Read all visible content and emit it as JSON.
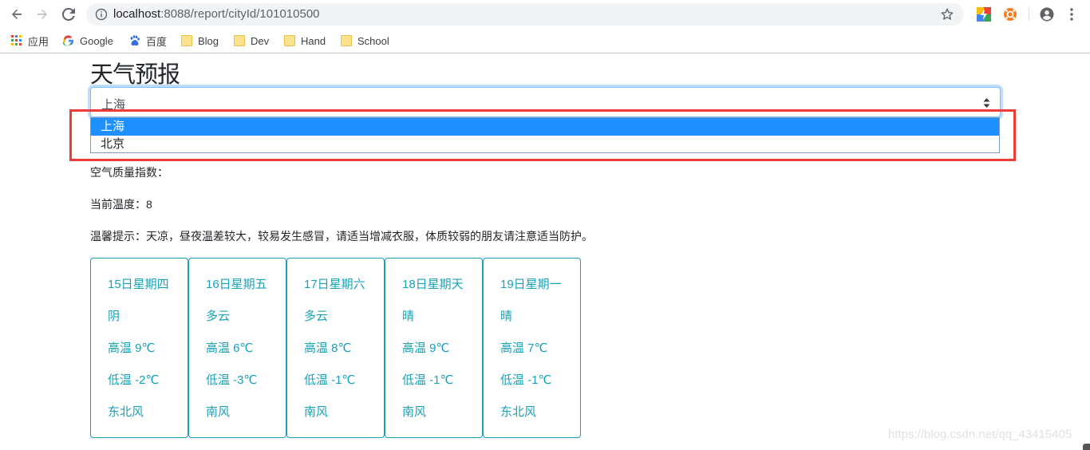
{
  "browser": {
    "url_host": "localhost",
    "url_path": ":8088/report/cityId/101010500",
    "bookmarks": [
      {
        "label": "应用",
        "icon": "apps-grid-icon"
      },
      {
        "label": "Google",
        "icon": "google-icon"
      },
      {
        "label": "百度",
        "icon": "baidu-paw-icon"
      },
      {
        "label": "Blog",
        "icon": "folder-icon"
      },
      {
        "label": "Dev",
        "icon": "folder-icon"
      },
      {
        "label": "Hand",
        "icon": "folder-icon"
      },
      {
        "label": "School",
        "icon": "folder-icon"
      }
    ]
  },
  "page": {
    "title": "天气预报",
    "city_select": {
      "value": "上海",
      "options": [
        "上海",
        "北京"
      ],
      "selected_index": 0
    },
    "aqi_label": "空气质量指数：",
    "current_temp_label": "当前温度：8",
    "tip_label": "温馨提示：天凉，昼夜温差较大，较易发生感冒，请适当增减衣服，体质较弱的朋友请注意适当防护。",
    "forecast": [
      {
        "date": "15日星期四",
        "weather": "阴",
        "high": "高温 9℃",
        "low": "低温 -2℃",
        "wind": "东北风"
      },
      {
        "date": "16日星期五",
        "weather": "多云",
        "high": "高温 6℃",
        "low": "低温 -3℃",
        "wind": "南风"
      },
      {
        "date": "17日星期六",
        "weather": "多云",
        "high": "高温 8℃",
        "low": "低温 -1℃",
        "wind": "南风"
      },
      {
        "date": "18日星期天",
        "weather": "晴",
        "high": "高温 9℃",
        "low": "低温 -1℃",
        "wind": "南风"
      },
      {
        "date": "19日星期一",
        "weather": "晴",
        "high": "高温 7℃",
        "low": "低温 -1℃",
        "wind": "东北风"
      }
    ]
  },
  "watermark": "https://blog.csdn.net/qq_43415405",
  "colors": {
    "accent": "#17a2b8",
    "selected_option": "#1e90ff",
    "highlight": "#ef3a3a"
  }
}
